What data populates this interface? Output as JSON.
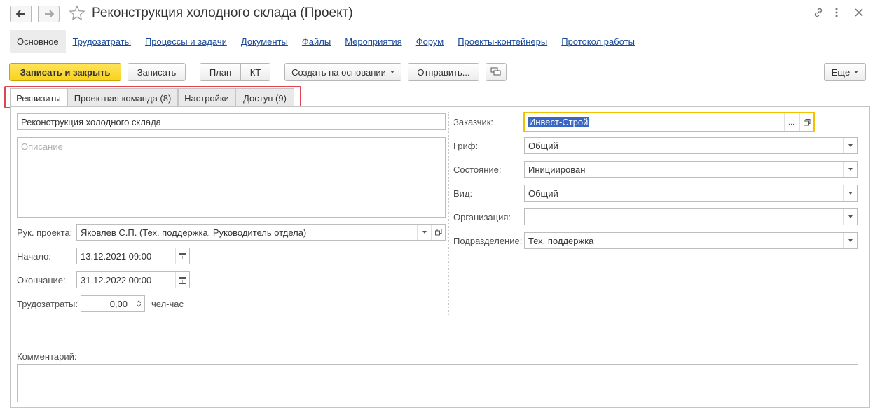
{
  "header": {
    "title": "Реконструкция холодного склада (Проект)"
  },
  "nav": {
    "active": "Основное",
    "links": [
      "Трудозатраты",
      "Процессы и задачи",
      "Документы",
      "Файлы",
      "Мероприятия",
      "Форум",
      "Проекты-контейнеры",
      "Протокол работы"
    ]
  },
  "toolbar": {
    "save_close": "Записать и закрыть",
    "save": "Записать",
    "plan": "План",
    "kt": "КТ",
    "create_based": "Создать на основании",
    "send": "Отправить...",
    "more": "Еще"
  },
  "tabs": [
    "Реквизиты",
    "Проектная команда (8)",
    "Настройки",
    "Доступ (9)"
  ],
  "left": {
    "name_value": "Реконструкция холодного склада",
    "description_placeholder": "Описание",
    "manager_label": "Рук. проекта:",
    "manager_value": "Яковлев С.П. (Тех. поддержка, Руководитель отдела)",
    "start_label": "Начало:",
    "start_value": "13.12.2021 09:00",
    "end_label": "Окончание:",
    "end_value": "31.12.2022 00:00",
    "labor_label": "Трудозатраты:",
    "labor_value": "0,00",
    "labor_unit": "чел-час",
    "comment_label": "Комментарий:"
  },
  "right": {
    "customer_label": "Заказчик:",
    "customer_value": "Инвест-Строй",
    "grif_label": "Гриф:",
    "grif_value": "Общий",
    "state_label": "Состояние:",
    "state_value": "Инициирован",
    "kind_label": "Вид:",
    "kind_value": "Общий",
    "org_label": "Организация:",
    "org_value": "",
    "dept_label": "Подразделение:",
    "dept_value": "Тех. поддержка"
  },
  "colors": {
    "primary_button": "#f7d21e",
    "link": "#1a4b9b",
    "tab_highlight": "#e0454f",
    "focus_border": "#f2c200",
    "selection": "#3a66c4"
  }
}
